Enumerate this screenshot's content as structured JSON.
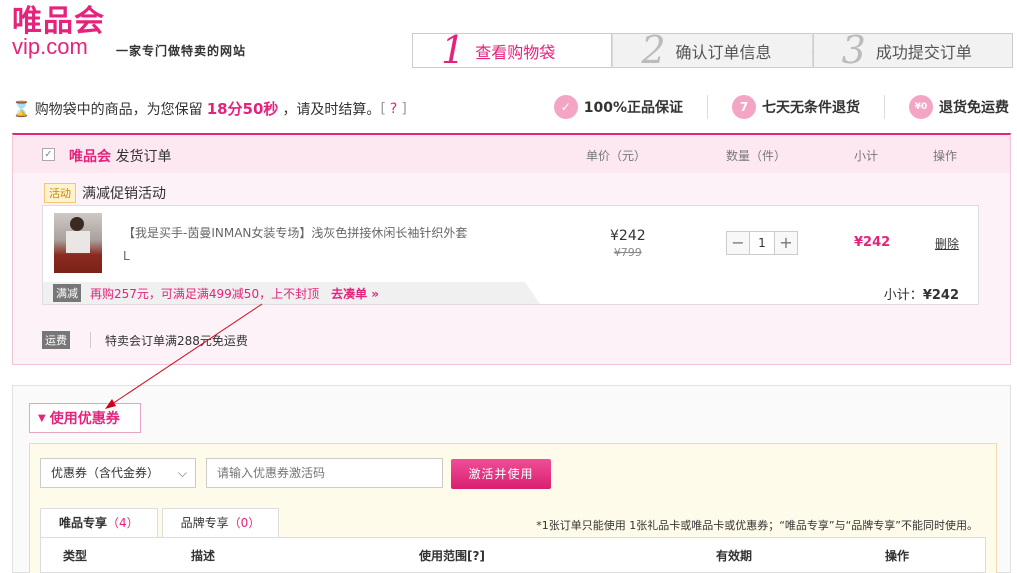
{
  "header": {
    "logo_cn": "唯品会",
    "logo_en": "vip.com",
    "slogan": "一家专门做特卖的网站",
    "steps": [
      {
        "num": "1",
        "label": "查看购物袋"
      },
      {
        "num": "2",
        "label": "确认订单信息"
      },
      {
        "num": "3",
        "label": "成功提交订单"
      }
    ]
  },
  "timer": {
    "prefix": "购物袋中的商品，为您保留",
    "time": "18分50秒",
    "suffix": "，请及时结算。",
    "help_open": "[",
    "help": "?",
    "help_close": "]"
  },
  "guarantees": [
    {
      "icon": "shield-icon",
      "glyph": "✓",
      "label": "100%正品保证"
    },
    {
      "icon": "seven-icon",
      "glyph": "7",
      "label": "七天无条件退货"
    },
    {
      "icon": "return-icon",
      "glyph": "¥0",
      "label": "退货免运费"
    }
  ],
  "cart": {
    "brand_main": "唯品会",
    "brand_sub": "发货订单",
    "columns": {
      "price": "单价（元）",
      "qty": "数量（件）",
      "subtotal": "小计",
      "action": "操作"
    },
    "promo_tag": "活动",
    "promo_label": "满减促销活动",
    "item": {
      "title": "【我是买手-茵曼INMAN女装专场】浅灰色拼接休闲长袖针织外套",
      "size": "L",
      "price": "¥242",
      "orig_price": "¥799",
      "qty": "1",
      "qty_minus": "−",
      "qty_plus": "+",
      "subtotal": "¥242",
      "delete": "删除"
    },
    "fullred_tag": "满减",
    "fullred_text": "再购257元，可满足满499减50，上不封顶",
    "fullred_link": "去凑单 »",
    "subtotal_label": "小计：",
    "subtotal_value": "¥242",
    "ship_tag": "运费",
    "ship_text": "特卖会订单满288元免运费"
  },
  "coupon": {
    "toggle_label": "使用优惠券",
    "select_value": "优惠券（含代金券）",
    "code_placeholder": "请输入优惠券激活码",
    "activate_label": "激活并使用",
    "tabs": [
      {
        "label": "唯品专享",
        "count": "（4）"
      },
      {
        "label": "品牌专享",
        "count": "（0）"
      }
    ],
    "note": "*1张订单只能使用 1张礼品卡或唯品卡或优惠券；“唯品专享”与“品牌专享”不能同时使用。",
    "table_headers": {
      "type": "类型",
      "desc": "描述",
      "scope": "使用范围[?]",
      "validity": "有效期",
      "action": "操作"
    }
  },
  "colors": {
    "brand": "#e5237c",
    "panel_bg": "#fdf2f7",
    "coupon_bg": "#fffbea"
  }
}
